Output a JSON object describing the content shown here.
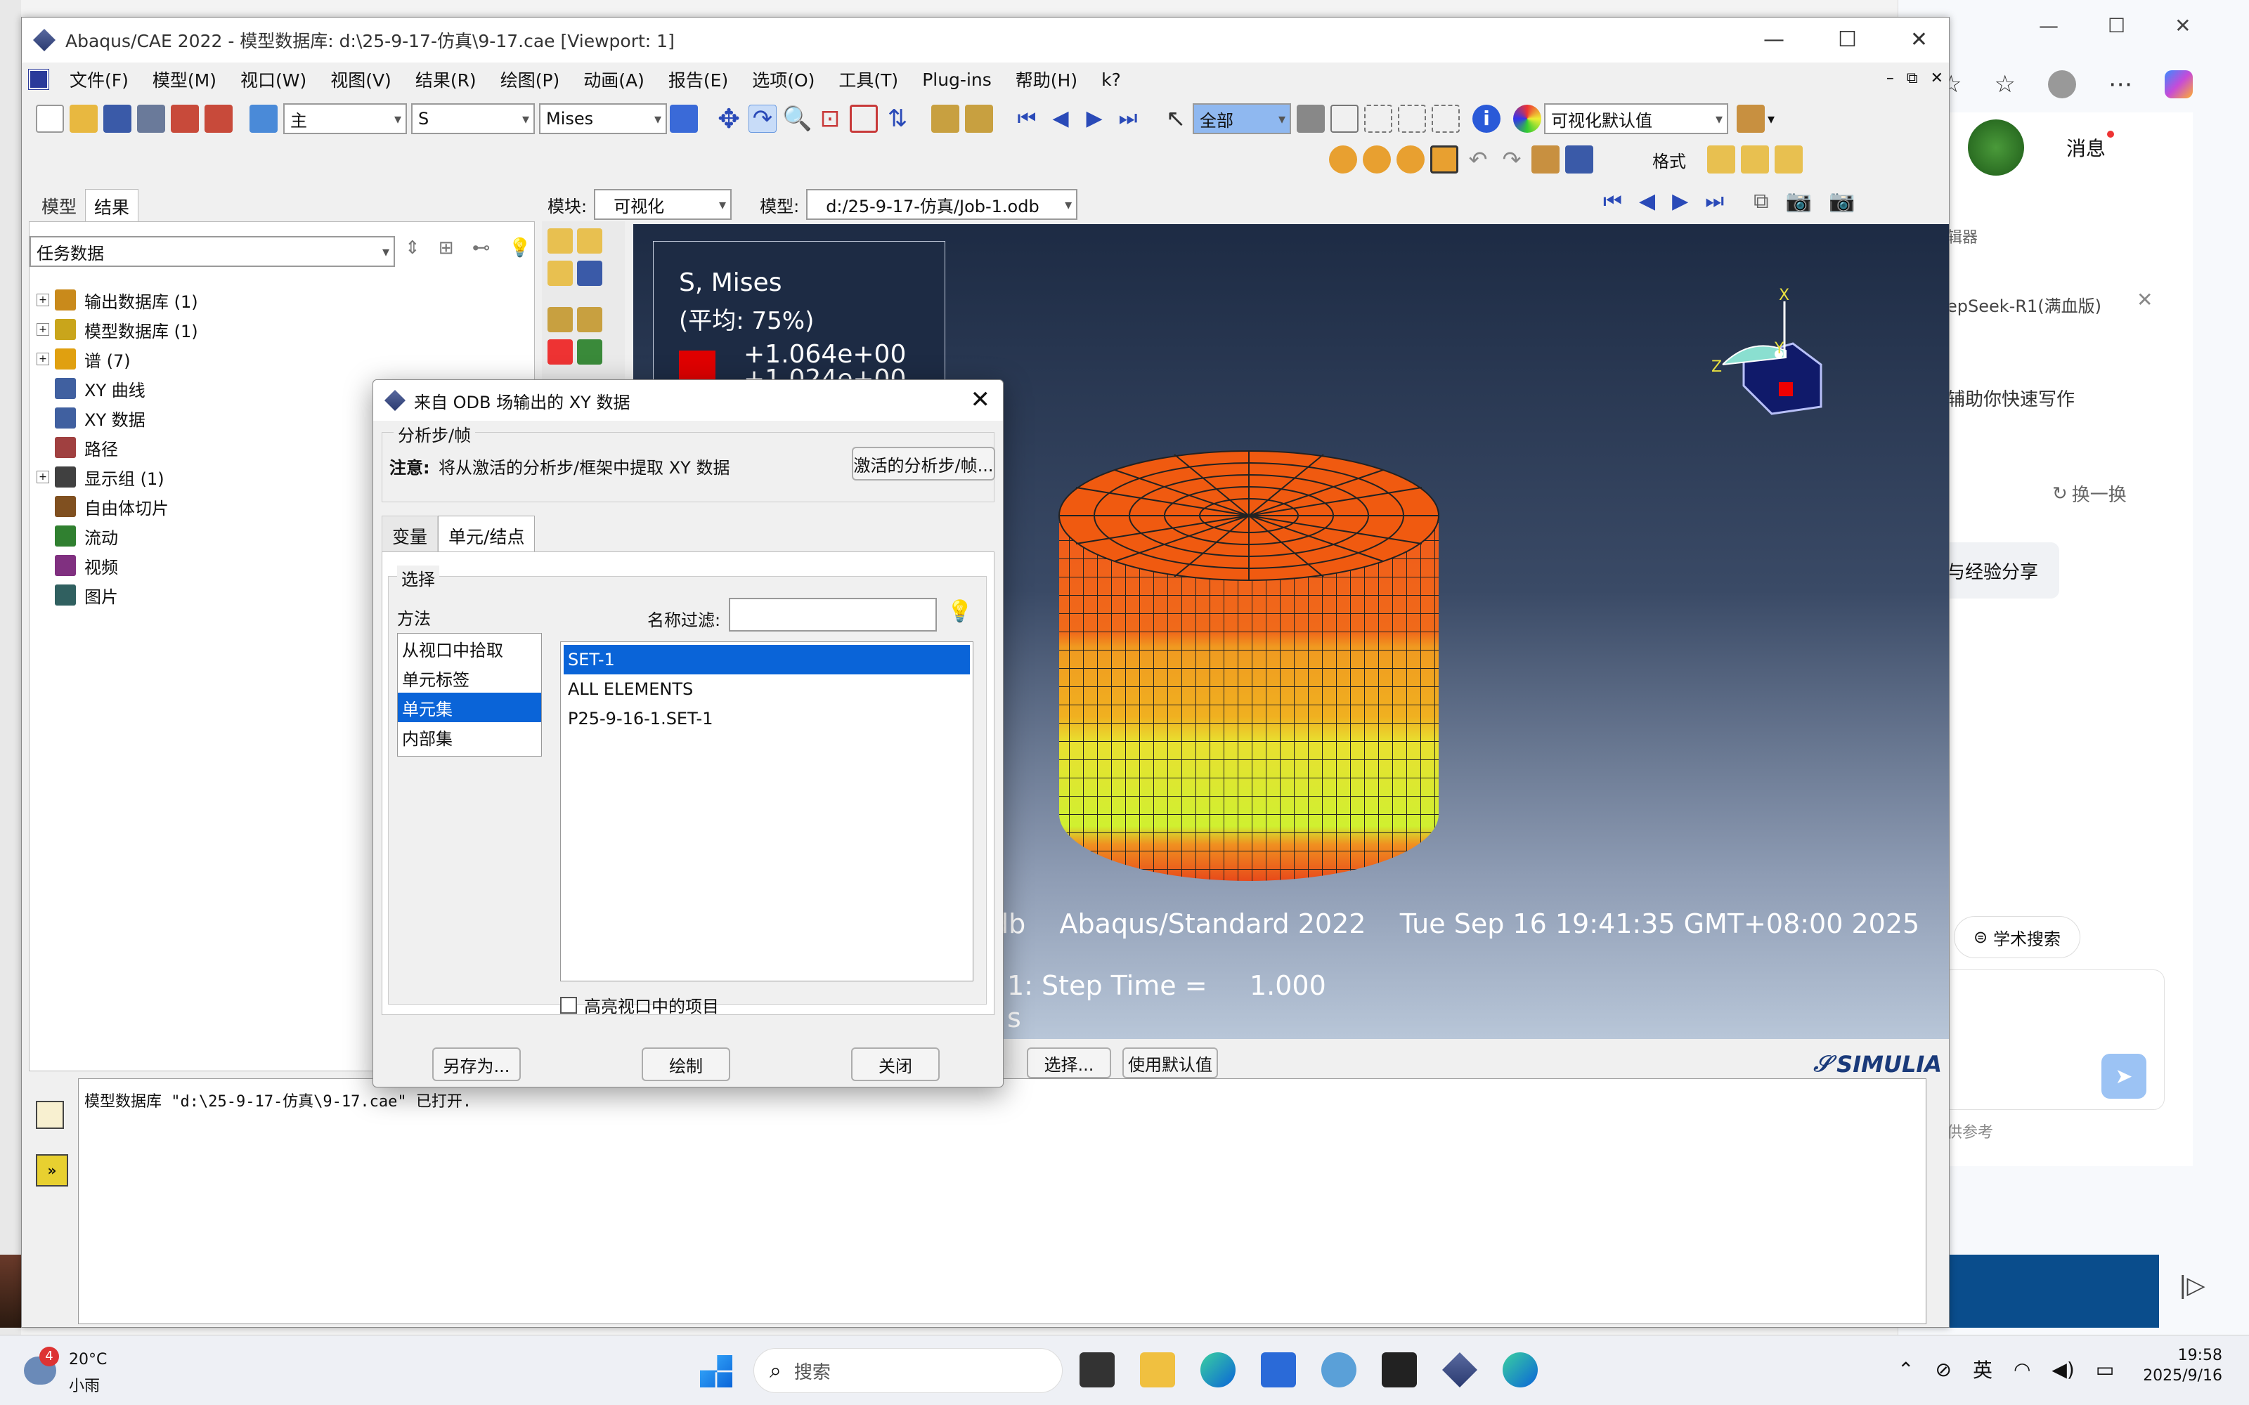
{
  "app": {
    "title": "Abaqus/CAE 2022 - 模型数据库: d:\\25-9-17-仿真\\9-17.cae [Viewport: 1]",
    "menu": [
      "文件(F)",
      "模型(M)",
      "视口(W)",
      "视图(V)",
      "结果(R)",
      "绘图(P)",
      "动画(A)",
      "报告(E)",
      "选项(O)",
      "工具(T)",
      "Plug-ins",
      "帮助(H)",
      "k?"
    ]
  },
  "toolbar": {
    "combo1": "主",
    "combo2": "S",
    "combo3": "Mises",
    "combo_all": "全部",
    "combo_vis": "可视化默认值",
    "format_label": "格式"
  },
  "context": {
    "module_label": "模块:",
    "module_value": "可视化",
    "model_label": "模型:",
    "model_value": "d:/25-9-17-仿真/Job-1.odb"
  },
  "left_panel": {
    "tab_model": "模型",
    "tab_results": "结果",
    "combo": "任务数据",
    "tree": [
      {
        "label": "输出数据库 (1)",
        "expand": true,
        "color": "#c98a1b"
      },
      {
        "label": "模型数据库 (1)",
        "expand": true,
        "color": "#c9a51b"
      },
      {
        "label": "谱 (7)",
        "expand": true,
        "color": "#e0a010"
      },
      {
        "label": "XY 曲线",
        "expand": false,
        "color": "#4060a0"
      },
      {
        "label": "XY 数据",
        "expand": false,
        "color": "#4060a0"
      },
      {
        "label": "路径",
        "expand": false,
        "color": "#a04040"
      },
      {
        "label": "显示组 (1)",
        "expand": true,
        "color": "#404040"
      },
      {
        "label": "自由体切片",
        "expand": false,
        "color": "#805020"
      },
      {
        "label": "流动",
        "expand": false,
        "color": "#308030"
      },
      {
        "label": "视频",
        "expand": false,
        "color": "#803080"
      },
      {
        "label": "图片",
        "expand": false,
        "color": "#306060"
      }
    ]
  },
  "legend": {
    "title": "S, Mises",
    "avg": "(平均: 75%)",
    "v1": "+1.064e+00",
    "v2": "+1.024e+00"
  },
  "viewport": {
    "info1": "db    Abaqus/Standard 2022    Tue Sep 16 19:41:35 GMT+08:00 2025",
    "info2": "1: Step Time =     1.000",
    "info3": "s",
    "axis_x": "X",
    "axis_y": "Y",
    "axis_z": "Z",
    "brand": "SIMULIA",
    "btn_select": "选择...",
    "btn_default": "使用默认值"
  },
  "dialog": {
    "title": "来自 ODB 场输出的 XY 数据",
    "group_step": "分析步/帧",
    "note_label": "注意:",
    "note_text": "将从激活的分析步/框架中提取 XY 数据",
    "btn_active_step": "激活的分析步/帧...",
    "tab_variables": "变量",
    "tab_elements": "单元/结点",
    "group_select": "选择",
    "method_label": "方法",
    "methods": [
      "从视口中拾取",
      "单元标签",
      "单元集",
      "内部集"
    ],
    "method_selected": 2,
    "filter_label": "名称过滤:",
    "sets": [
      "SET-1",
      "ALL ELEMENTS",
      "P25-9-16-1.SET-1"
    ],
    "set_selected": 0,
    "highlight_label": "高亮视口中的项目",
    "btn_saveas": "另存为...",
    "btn_plot": "绘制",
    "btn_close": "关闭"
  },
  "message": {
    "text": "模型数据库 \"d:\\25-9-17-仿真\\9-17.cae\" 已打开."
  },
  "side_panel": {
    "message": "消息",
    "item1": "辑器",
    "item2": "epSeek-R1(满血版)",
    "item3": "辅助你快速写作",
    "refresh": "换一换",
    "item4": "与经验分享",
    "search": "学术搜索",
    "footer": "供参考"
  },
  "taskbar": {
    "weather_temp": "20°C",
    "weather_desc": "小雨",
    "weather_badge": "4",
    "search": "搜索",
    "lang": "英",
    "time": "19:58",
    "date": "2025/9/16"
  },
  "colors": {
    "accent": "#0a64d8",
    "viewport_top": "#1d2b44",
    "viewport_bottom": "#b8c6d8"
  }
}
